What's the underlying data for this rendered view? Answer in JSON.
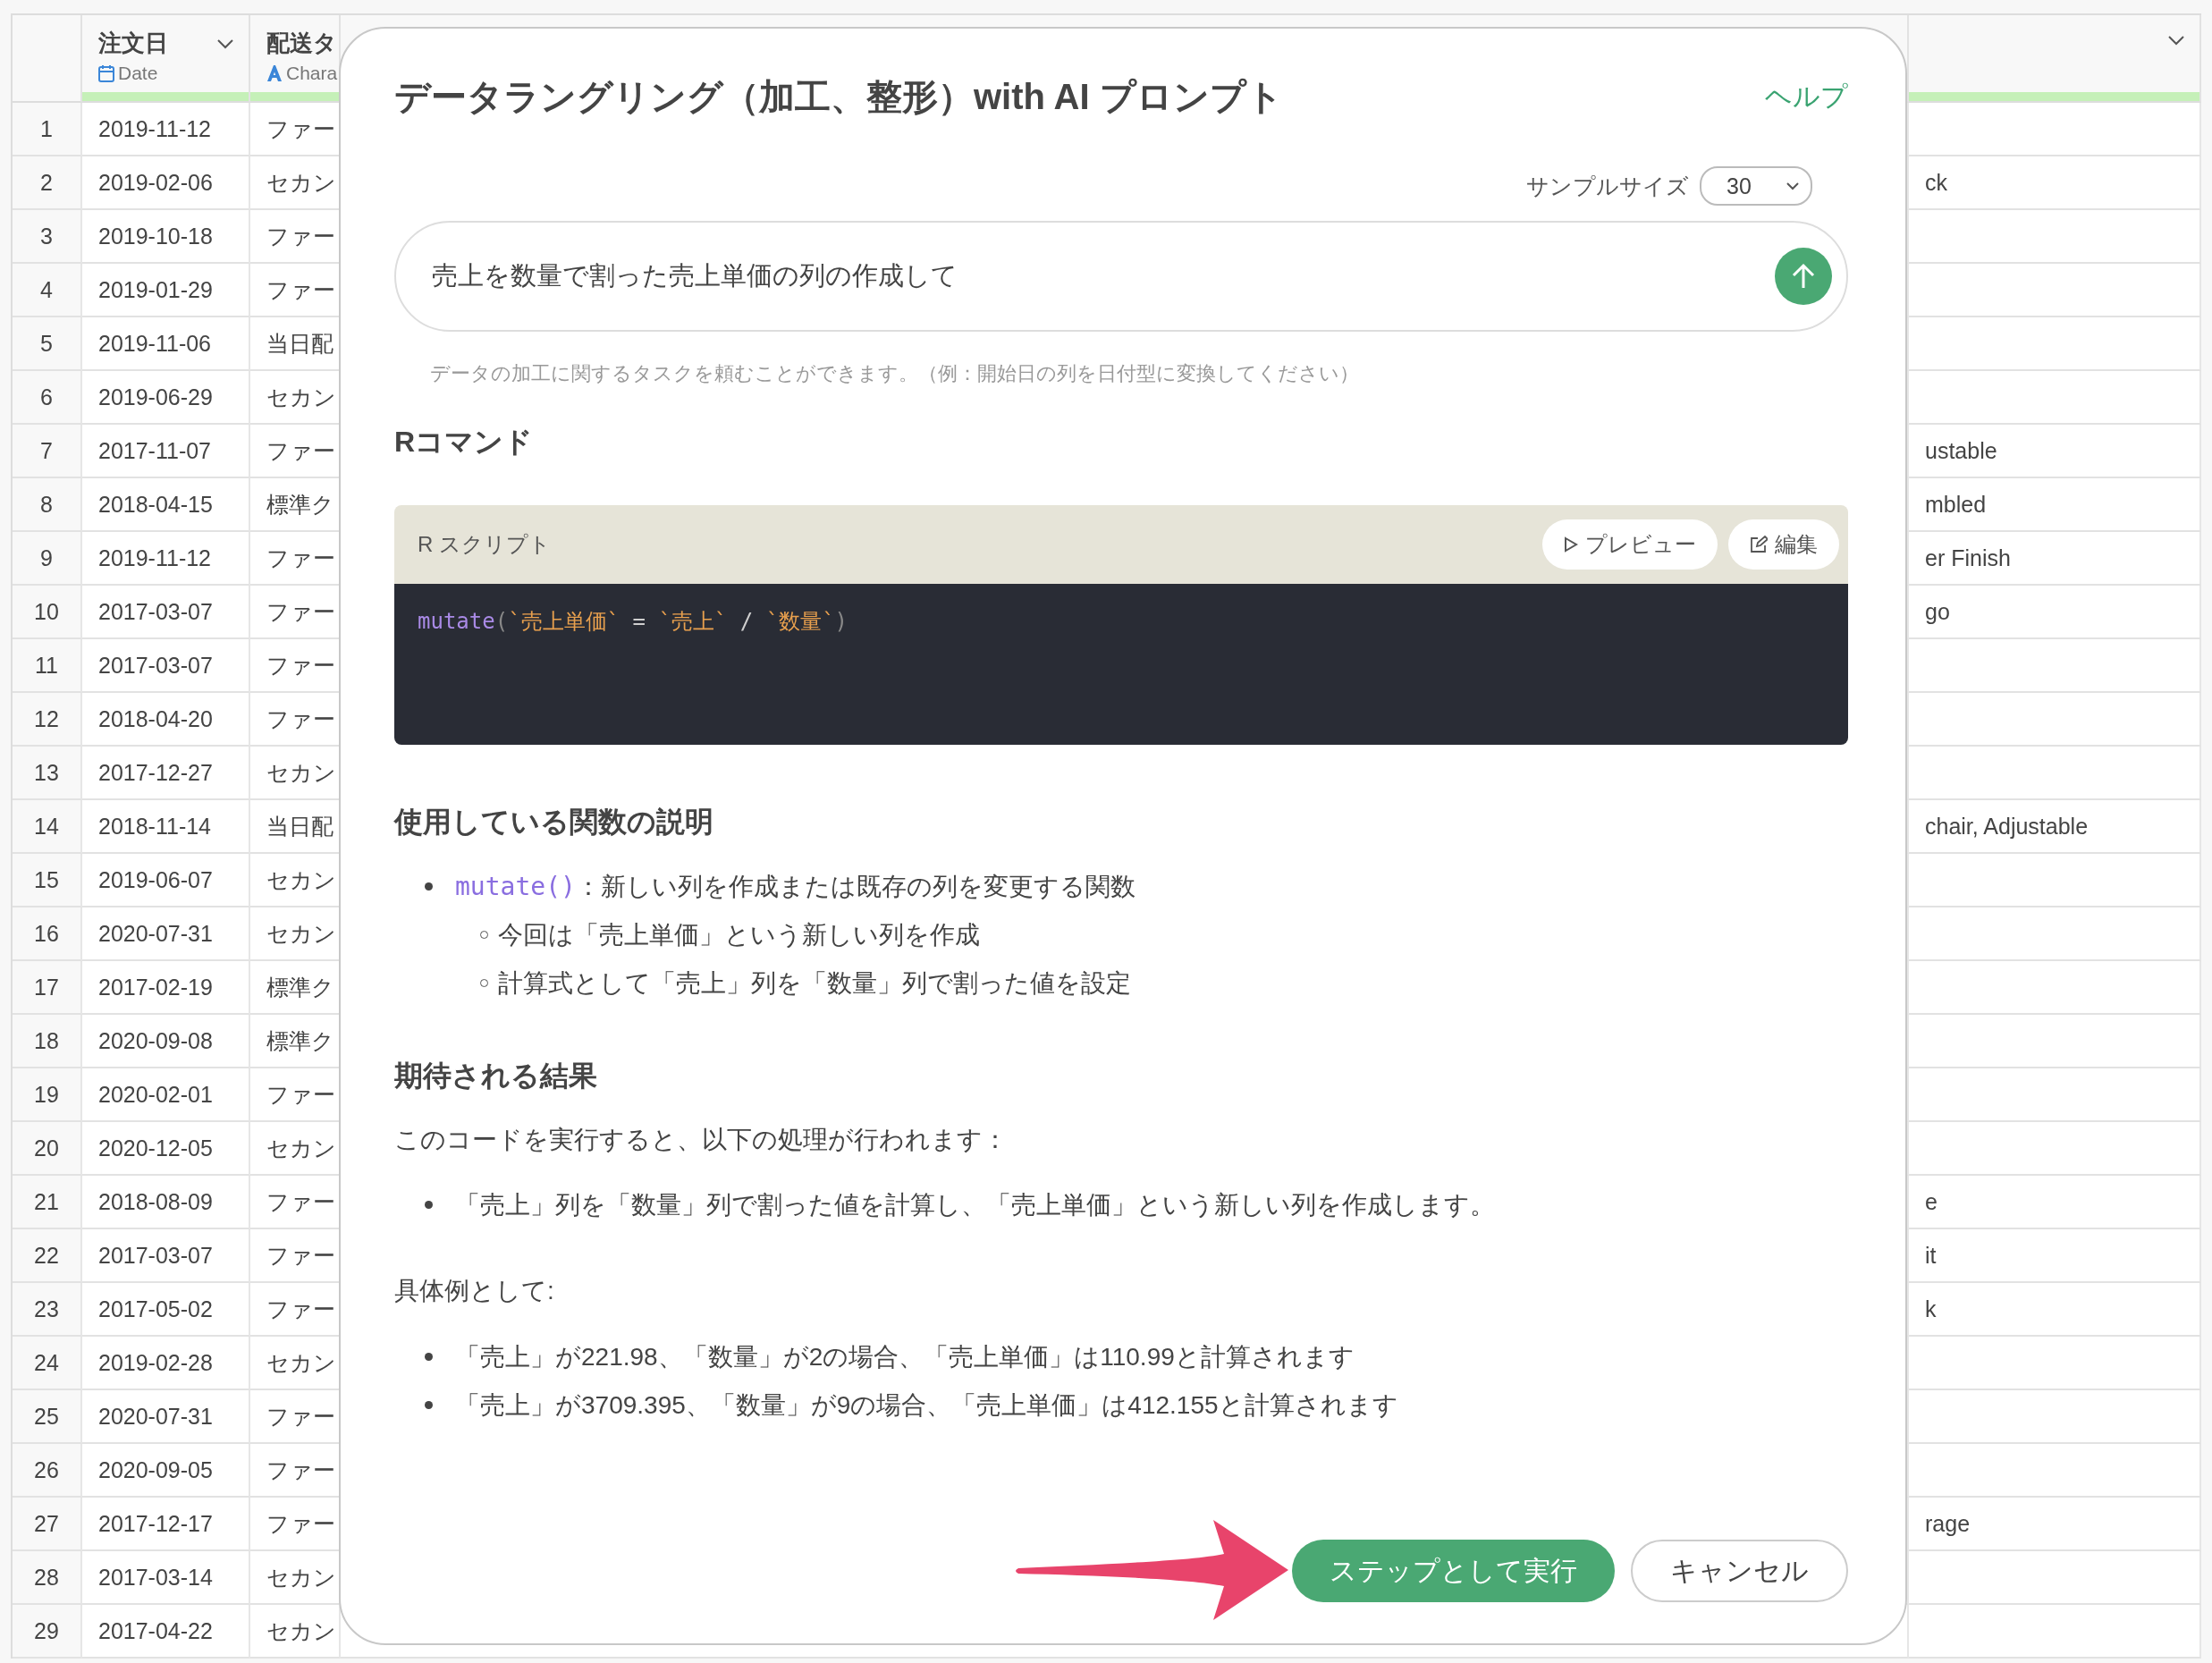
{
  "table": {
    "columns": [
      {
        "kind": "date",
        "title": "注文日",
        "type_label": "Date"
      },
      {
        "kind": "character",
        "title": "配送タ",
        "type_label": "Chara"
      }
    ],
    "rows": [
      {
        "number": "1",
        "order_date": "2019-11-12",
        "delivery_type": "ファー"
      },
      {
        "number": "2",
        "order_date": "2019-02-06",
        "delivery_type": "セカン",
        "last_column": "ck"
      },
      {
        "number": "3",
        "order_date": "2019-10-18",
        "delivery_type": "ファー"
      },
      {
        "number": "4",
        "order_date": "2019-01-29",
        "delivery_type": "ファー"
      },
      {
        "number": "5",
        "order_date": "2019-11-06",
        "delivery_type": "当日配"
      },
      {
        "number": "6",
        "order_date": "2019-06-29",
        "delivery_type": "セカン"
      },
      {
        "number": "7",
        "order_date": "2017-11-07",
        "delivery_type": "ファー",
        "last_column": "ustable"
      },
      {
        "number": "8",
        "order_date": "2018-04-15",
        "delivery_type": "標準ク",
        "last_column": "mbled"
      },
      {
        "number": "9",
        "order_date": "2019-11-12",
        "delivery_type": "ファー",
        "last_column": "er Finish"
      },
      {
        "number": "10",
        "order_date": "2017-03-07",
        "delivery_type": "ファー",
        "last_column": "go"
      },
      {
        "number": "11",
        "order_date": "2017-03-07",
        "delivery_type": "ファー"
      },
      {
        "number": "12",
        "order_date": "2018-04-20",
        "delivery_type": "ファー"
      },
      {
        "number": "13",
        "order_date": "2017-12-27",
        "delivery_type": "セカン"
      },
      {
        "number": "14",
        "order_date": "2018-11-14",
        "delivery_type": "当日配",
        "last_column": "chair, Adjustable"
      },
      {
        "number": "15",
        "order_date": "2019-06-07",
        "delivery_type": "セカン"
      },
      {
        "number": "16",
        "order_date": "2020-07-31",
        "delivery_type": "セカン"
      },
      {
        "number": "17",
        "order_date": "2017-02-19",
        "delivery_type": "標準ク"
      },
      {
        "number": "18",
        "order_date": "2020-09-08",
        "delivery_type": "標準ク"
      },
      {
        "number": "19",
        "order_date": "2020-02-01",
        "delivery_type": "ファー"
      },
      {
        "number": "20",
        "order_date": "2020-12-05",
        "delivery_type": "セカン"
      },
      {
        "number": "21",
        "order_date": "2018-08-09",
        "delivery_type": "ファー",
        "last_column": "e"
      },
      {
        "number": "22",
        "order_date": "2017-03-07",
        "delivery_type": "ファー",
        "last_column": "it"
      },
      {
        "number": "23",
        "order_date": "2017-05-02",
        "delivery_type": "ファー",
        "last_column": "k"
      },
      {
        "number": "24",
        "order_date": "2019-02-28",
        "delivery_type": "セカン"
      },
      {
        "number": "25",
        "order_date": "2020-07-31",
        "delivery_type": "ファー"
      },
      {
        "number": "26",
        "order_date": "2020-09-05",
        "delivery_type": "ファー"
      },
      {
        "number": "27",
        "order_date": "2017-12-17",
        "delivery_type": "ファー",
        "last_column": "rage"
      },
      {
        "number": "28",
        "order_date": "2017-03-14",
        "delivery_type": "セカン"
      },
      {
        "number": "29",
        "order_date": "2017-04-22",
        "delivery_type": "セカン"
      }
    ]
  },
  "dialog": {
    "title": "データラングリング（加工、整形）with AI プロンプト",
    "help_link": "ヘルプ",
    "sample_size": {
      "label": "サンプルサイズ",
      "value": "30"
    },
    "prompt": {
      "value": "売上を数量で割った売上単価の列の作成して"
    },
    "hint": "データの加工に関するタスクを頼むことができます。（例：開始日の列を日付型に変換してください）",
    "r_command": {
      "heading": "Rコマンド",
      "script_label": "R スクリプト",
      "buttons": [
        {
          "kind": "preview",
          "label": "プレビュー"
        },
        {
          "kind": "edit",
          "label": "編集"
        }
      ],
      "code": [
        {
          "kind": "function",
          "text": "mutate"
        },
        {
          "kind": "punct",
          "text": "("
        },
        {
          "kind": "name",
          "text": "`売上単価`"
        },
        {
          "kind": "operator",
          "text": " = "
        },
        {
          "kind": "name",
          "text": "`売上`"
        },
        {
          "kind": "operator",
          "text": " / "
        },
        {
          "kind": "name",
          "text": "`数量`"
        },
        {
          "kind": "punct",
          "text": ")"
        }
      ]
    },
    "functions": {
      "heading": "使用している関数の説明",
      "items": [
        {
          "code": "mutate()",
          "text": "：新しい列を作成または既存の列を変更する関数",
          "children": [
            {
              "text": "今回は「売上単価」という新しい列を作成"
            },
            {
              "text": "計算式として「売上」列を「数量」列で割った値を設定"
            }
          ]
        }
      ]
    },
    "expected": {
      "heading": "期待される結果",
      "intro": "このコードを実行すると、以下の処理が行われます：",
      "bullets": [
        "「売上」列を「数量」列で割った値を計算し、「売上単価」という新しい列を作成します。"
      ],
      "example_label": "具体例として:",
      "example_bullets": [
        "「売上」が221.98、「数量」が2の場合、「売上単価」は110.99と計算されます",
        "「売上」が3709.395、「数量」が9の場合、「売上単価」は412.155と計算されます"
      ]
    },
    "buttons": [
      {
        "kind": "primary",
        "label": "ステップとして実行"
      },
      {
        "kind": "secondary",
        "label": "キャンセル"
      }
    ]
  }
}
